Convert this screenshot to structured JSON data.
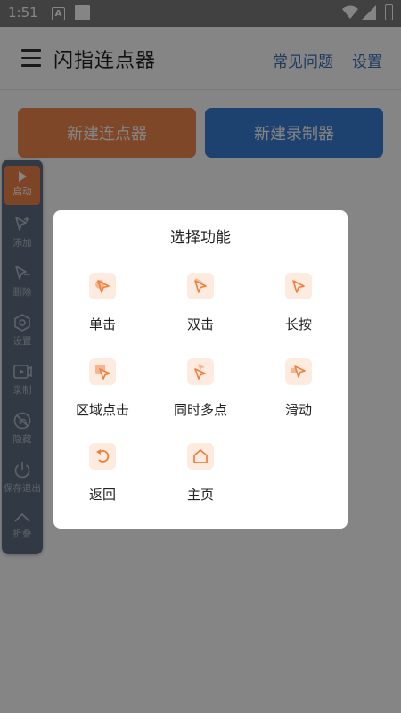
{
  "status_bar": {
    "time": "1:51",
    "a_icon_label": "A"
  },
  "app_bar": {
    "title": "闪指连点器",
    "faq_label": "常见问题",
    "settings_label": "设置"
  },
  "primary_buttons": {
    "new_clicker": "新建连点器",
    "new_recorder": "新建录制器"
  },
  "colors": {
    "accent_orange": "#f2884c",
    "accent_blue": "#3b7fd7",
    "panel_bg": "#5f6f82",
    "link_blue": "#3a72b8"
  },
  "float_panel": {
    "items": [
      {
        "label": "启动",
        "icon": "play-icon"
      },
      {
        "label": "添加",
        "icon": "add-pointer-icon"
      },
      {
        "label": "删除",
        "icon": "remove-pointer-icon"
      },
      {
        "label": "设置",
        "icon": "hexagon-gear-icon"
      },
      {
        "label": "录制",
        "icon": "record-icon"
      },
      {
        "label": "隐藏",
        "icon": "hide-icon"
      },
      {
        "label": "保存退出",
        "icon": "power-icon"
      },
      {
        "label": "折叠",
        "icon": "chevron-up-icon"
      }
    ]
  },
  "modal": {
    "title": "选择功能",
    "functions": [
      {
        "label": "单击",
        "icon": "single-tap-icon"
      },
      {
        "label": "双击",
        "icon": "double-tap-icon"
      },
      {
        "label": "长按",
        "icon": "long-press-icon"
      },
      {
        "label": "区域点击",
        "icon": "area-click-icon"
      },
      {
        "label": "同时多点",
        "icon": "multi-point-icon"
      },
      {
        "label": "滑动",
        "icon": "swipe-icon"
      },
      {
        "label": "返回",
        "icon": "back-icon"
      },
      {
        "label": "主页",
        "icon": "home-icon"
      }
    ]
  }
}
